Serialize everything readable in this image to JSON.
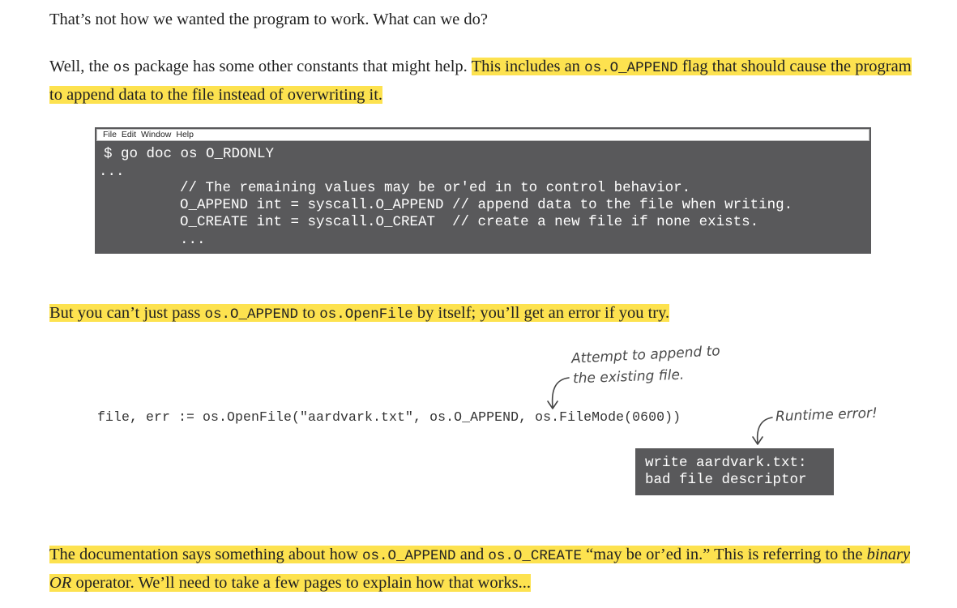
{
  "paragraphs": {
    "p1": "That’s not how we wanted the program to work. What can we do?",
    "p2_before": "Well, the ",
    "p2_code1": "os",
    "p2_mid": " package has some other constants that might help. ",
    "p2_hl_a": "This includes an ",
    "p2_hl_code": "os.O_APPEND",
    "p2_hl_b": " flag that should cause the program to append data to the file instead of overwriting it.",
    "p3_a": "But you can’t just pass ",
    "p3_code1": "os.O_APPEND",
    "p3_b": " to ",
    "p3_code2": "os.OpenFile",
    "p3_c": " by itself; you’ll get an error if you try.",
    "p4_a": "The documentation says something about how ",
    "p4_code1": "os.O_APPEND",
    "p4_b": " and ",
    "p4_code2": "os.O_CREATE",
    "p4_c": " “may be or’ed in.” This is referring to the ",
    "p4_em": "binary OR",
    "p4_d": " operator. We’ll need to take a few pages to explain how that works..."
  },
  "terminal": {
    "menu": [
      "File",
      "Edit",
      "Window",
      "Help"
    ],
    "lines": [
      "$ go doc os O_RDONLY",
      "...",
      "// The remaining values may be or'ed in to control behavior.",
      "O_APPEND int = syscall.O_APPEND // append data to the file when writing.",
      "O_CREATE int = syscall.O_CREAT  // create a new file if none exists.",
      "..."
    ]
  },
  "code_example": "file, err := os.OpenFile(\"aardvark.txt\", os.O_APPEND, os.FileMode(0600))",
  "annotations": {
    "append_note_line1": "Attempt to append to",
    "append_note_line2": "the existing file.",
    "runtime_note": "Runtime error!"
  },
  "error_output": "write aardvark.txt:\nbad file descriptor",
  "colors": {
    "highlight": "#fde24f",
    "terminal_bg": "#59595b"
  }
}
